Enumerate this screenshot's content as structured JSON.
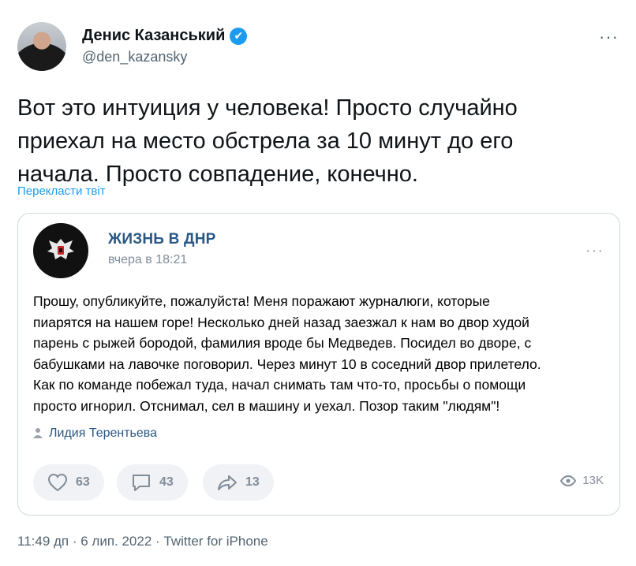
{
  "author": {
    "name": "Денис Казанський",
    "handle": "@den_kazansky",
    "verified_mark": "✔"
  },
  "more_glyph": "···",
  "tweet_text": "Вот это интуиция у человека! Просто случайно\nприехал на место обстрела за 10 минут до его\nначала. Просто совпадение,  конечно.",
  "translate_label": "Перекласти твіт",
  "embedded_post": {
    "group_name": "ЖИЗНЬ В ДНР",
    "time": "вчера в 18:21",
    "more_glyph": "···",
    "lines": [
      "Прошу, опубликуйте, пожалуйста! Меня поражают журналюги, которые",
      "пиарятся на нашем горе! Несколько дней назад заезжал к нам во двор худой",
      "парень с рыжей бородой, фамилия вроде бы Медведев. Посидел во дворе, с",
      "бабушками на лавочке поговорил. Через минут 10 в соседний двор прилетело.",
      "Как по команде побежал туда, начал снимать там что-то, просьбы о помощи",
      "просто игнорил. Отснимал, сел в машину и уехал. Позор таким \"людям\"!"
    ],
    "author_name": "Лидия Терентьева",
    "likes": "63",
    "comments": "43",
    "shares": "13",
    "views": "13K"
  },
  "footer": "11:49 дп · 6 лип. 2022 · Twitter for iPhone",
  "colors": {
    "accent": "#1d9bf0",
    "vk_link": "#2a5885",
    "muted": "#536471"
  }
}
